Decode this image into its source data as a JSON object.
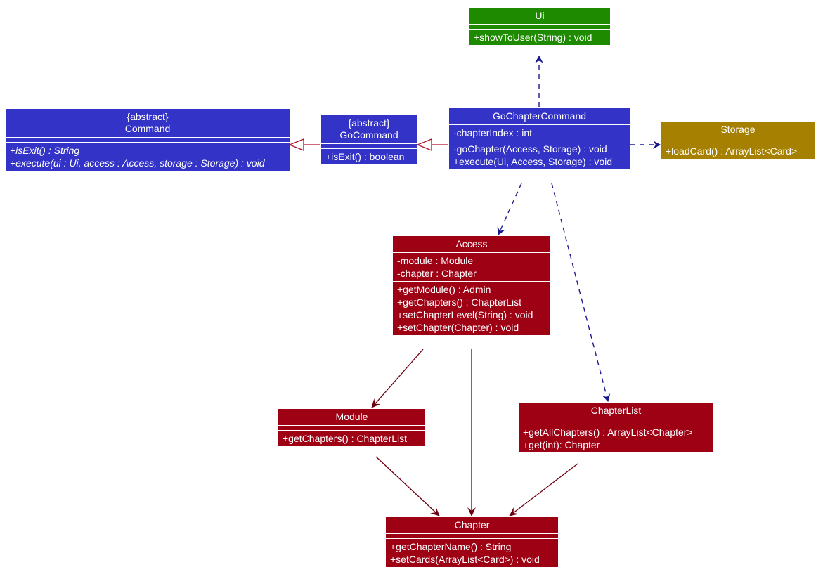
{
  "diagram": {
    "type": "uml-class-diagram",
    "colors": {
      "ui_class": "#1e8a00",
      "logic_class": "#3333c8",
      "storage_class": "#a68000",
      "model_class": "#9e0014",
      "dependency_arrow": "#1a1a8c",
      "inheritance_arrow": "#b0102a",
      "association_arrow": "#6b0010"
    },
    "classes": {
      "ui": {
        "name": "Ui",
        "attributes": [],
        "methods": [
          "+showToUser(String) : void"
        ]
      },
      "command": {
        "stereotype": "{abstract}",
        "name": "Command",
        "attributes": [],
        "methods": [
          "+isExit() : String",
          "+execute(ui : Ui, access : Access, storage : Storage) : void"
        ]
      },
      "go_command": {
        "stereotype": "{abstract}",
        "name": "GoCommand",
        "attributes": [],
        "methods": [
          "+isExit() : boolean"
        ]
      },
      "go_chapter_command": {
        "name": "GoChapterCommand",
        "attributes": [
          "-chapterIndex : int"
        ],
        "methods": [
          "-goChapter(Access, Storage) : void",
          "+execute(Ui, Access, Storage) : void"
        ]
      },
      "storage": {
        "name": "Storage",
        "attributes": [],
        "methods": [
          "+loadCard() : ArrayList<Card>"
        ]
      },
      "access": {
        "name": "Access",
        "attributes": [
          "-module : Module",
          "-chapter : Chapter"
        ],
        "methods": [
          "+getModule() : Admin",
          "+getChapters() : ChapterList",
          "+setChapterLevel(String) : void",
          "+setChapter(Chapter) : void"
        ]
      },
      "module": {
        "name": "Module",
        "attributes": [],
        "methods": [
          "+getChapters() : ChapterList"
        ]
      },
      "chapter_list": {
        "name": "ChapterList",
        "attributes": [],
        "methods": [
          "+getAllChapters() : ArrayList<Chapter>",
          "+get(int): Chapter"
        ]
      },
      "chapter": {
        "name": "Chapter",
        "attributes": [],
        "methods": [
          "+getChapterName() : String",
          "+setCards(ArrayList<Card>) : void"
        ]
      }
    },
    "relationships": [
      {
        "from": "GoChapterCommand",
        "to": "Ui",
        "kind": "dependency"
      },
      {
        "from": "GoChapterCommand",
        "to": "Storage",
        "kind": "dependency"
      },
      {
        "from": "GoChapterCommand",
        "to": "Access",
        "kind": "dependency"
      },
      {
        "from": "GoChapterCommand",
        "to": "ChapterList",
        "kind": "dependency"
      },
      {
        "from": "GoChapterCommand",
        "to": "GoCommand",
        "kind": "inheritance"
      },
      {
        "from": "GoCommand",
        "to": "Command",
        "kind": "inheritance"
      },
      {
        "from": "Access",
        "to": "Module",
        "kind": "association"
      },
      {
        "from": "Access",
        "to": "Chapter",
        "kind": "association"
      },
      {
        "from": "Module",
        "to": "Chapter",
        "kind": "association"
      },
      {
        "from": "ChapterList",
        "to": "Chapter",
        "kind": "association"
      }
    ]
  }
}
